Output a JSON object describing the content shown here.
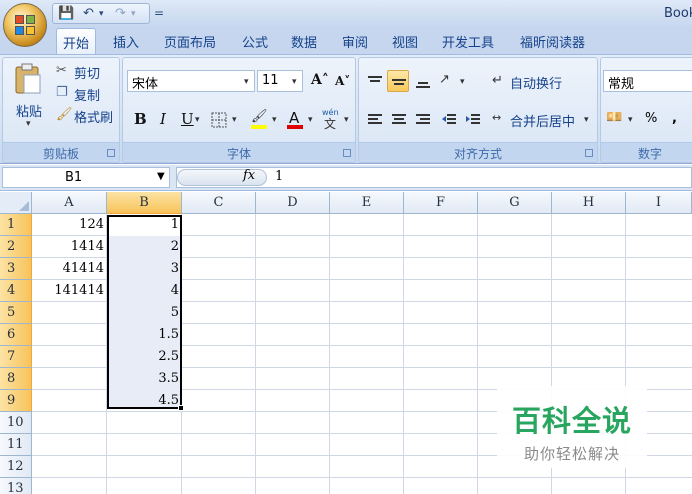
{
  "title": {
    "app_title": "Book",
    "qat_customize": "="
  },
  "tabs": [
    "开始",
    "插入",
    "页面布局",
    "公式",
    "数据",
    "审阅",
    "视图",
    "开发工具",
    "福昕阅读器"
  ],
  "ribbon": {
    "clipboard": {
      "paste": "粘贴",
      "cut": "剪切",
      "copy": "复制",
      "format_painter": "格式刷",
      "label": "剪贴板"
    },
    "font": {
      "name": "宋体",
      "size": "11",
      "bold": "B",
      "italic": "I",
      "underline": "U",
      "label": "字体"
    },
    "alignment": {
      "wrap_text": "自动换行",
      "merge_center": "合并后居中",
      "label": "对齐方式"
    },
    "number": {
      "format": "常规",
      "percent": "%",
      "comma": ",",
      "label": "数字"
    }
  },
  "formula_bar": {
    "name_box": "B1",
    "fx": "fx",
    "value": "1"
  },
  "sheet": {
    "columns": [
      "A",
      "B",
      "C",
      "D",
      "E",
      "F",
      "G",
      "H",
      "I"
    ],
    "rows": [
      "1",
      "2",
      "3",
      "4",
      "5",
      "6",
      "7",
      "8",
      "9",
      "10",
      "11",
      "12",
      "13"
    ],
    "col_a": [
      "124",
      "1414",
      "41414",
      "141414"
    ],
    "col_b": [
      "1",
      "2",
      "3",
      "4",
      "5",
      "1.5",
      "2.5",
      "3.5",
      "4.5"
    ]
  },
  "watermark": {
    "title": "百科全说",
    "subtitle": "助你轻松解决"
  },
  "colors": {
    "selected_header": "#f7c359",
    "watermark_green": "#28a660",
    "ribbon_text": "#15428b"
  }
}
